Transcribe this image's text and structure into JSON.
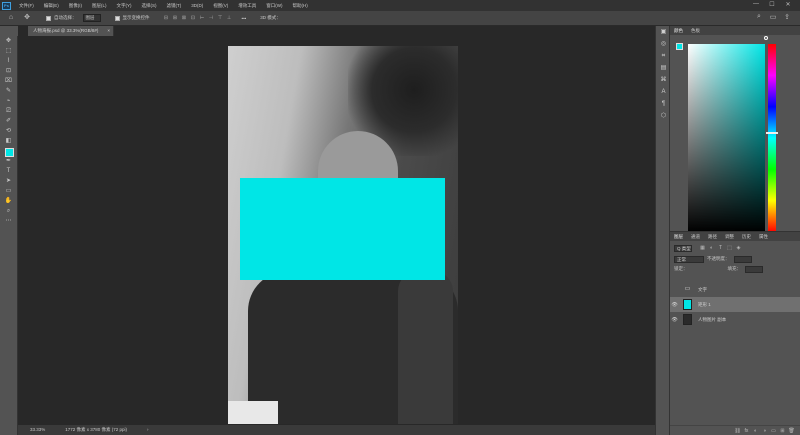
{
  "menubar": {
    "logo": "Ps",
    "items": [
      "文件(F)",
      "编辑(E)",
      "图像(I)",
      "图层(L)",
      "文字(Y)",
      "选择(S)",
      "滤镜(T)",
      "3D(D)",
      "视图(V)",
      "增效工具",
      "窗口(W)",
      "帮助(H)"
    ],
    "minimize": "—",
    "maximize": "☐",
    "close": "✕"
  },
  "options": {
    "home_icon": "⌂",
    "move_icon": "✥",
    "auto_select_label": "自动选择：",
    "auto_select_target": "图层",
    "show_transform_label": "显示变换控件",
    "align_icons": [
      "⊟",
      "⊞",
      "⊠",
      "⊡",
      "⊢",
      "⊣",
      "⊤",
      "⊥"
    ],
    "more_icon": "•••",
    "three_d_mode": "3D 模式：",
    "search_icon": "⌕",
    "workspace_icon": "▭",
    "share_icon": "⇪"
  },
  "document": {
    "tab_title": "人物海报.psd @ 33.3%(RGB/8#)",
    "tab_close": "×"
  },
  "tools": [
    "✥",
    "⬚",
    "⌇",
    "⊡",
    "⌧",
    "✎",
    "⌁",
    "⎚",
    "✐",
    "⟲",
    "◧",
    "⌖",
    "✒",
    "T",
    "➤",
    "▭",
    "✋",
    "⌕",
    "⋯"
  ],
  "status": {
    "zoom": "33.33%",
    "doc_size": "1772 像素 x 3780 像素 (72 ppi)",
    "arrow": "›"
  },
  "icon_strip": [
    "▣",
    "◎",
    "⌗",
    "▤",
    "⌘",
    "A",
    "¶",
    "⬡"
  ],
  "color_panel": {
    "tabs": [
      "颜色",
      "色板"
    ],
    "fg_color": "#00e6e6"
  },
  "layers_panel": {
    "tabs": [
      "图层",
      "通道",
      "路径",
      "调整",
      "历史",
      "属性"
    ],
    "kind_label": "Q 类型",
    "filter_icons": [
      "▦",
      "◐",
      "T",
      "⬚",
      "◈"
    ],
    "blend_mode": "正常",
    "opacity_label": "不透明度：",
    "lock_label": "锁定：",
    "fill_label": "填充：",
    "layers": [
      {
        "name": "文字",
        "type": "group"
      },
      {
        "name": "矩形 1",
        "type": "shape"
      },
      {
        "name": "人物图片 副本",
        "type": "image"
      }
    ],
    "footer_icons": [
      "⛓",
      "fx",
      "◐",
      "◑",
      "▭",
      "⊞",
      "🗑"
    ]
  },
  "colors": {
    "accent_cyan": "#00e6e6"
  }
}
